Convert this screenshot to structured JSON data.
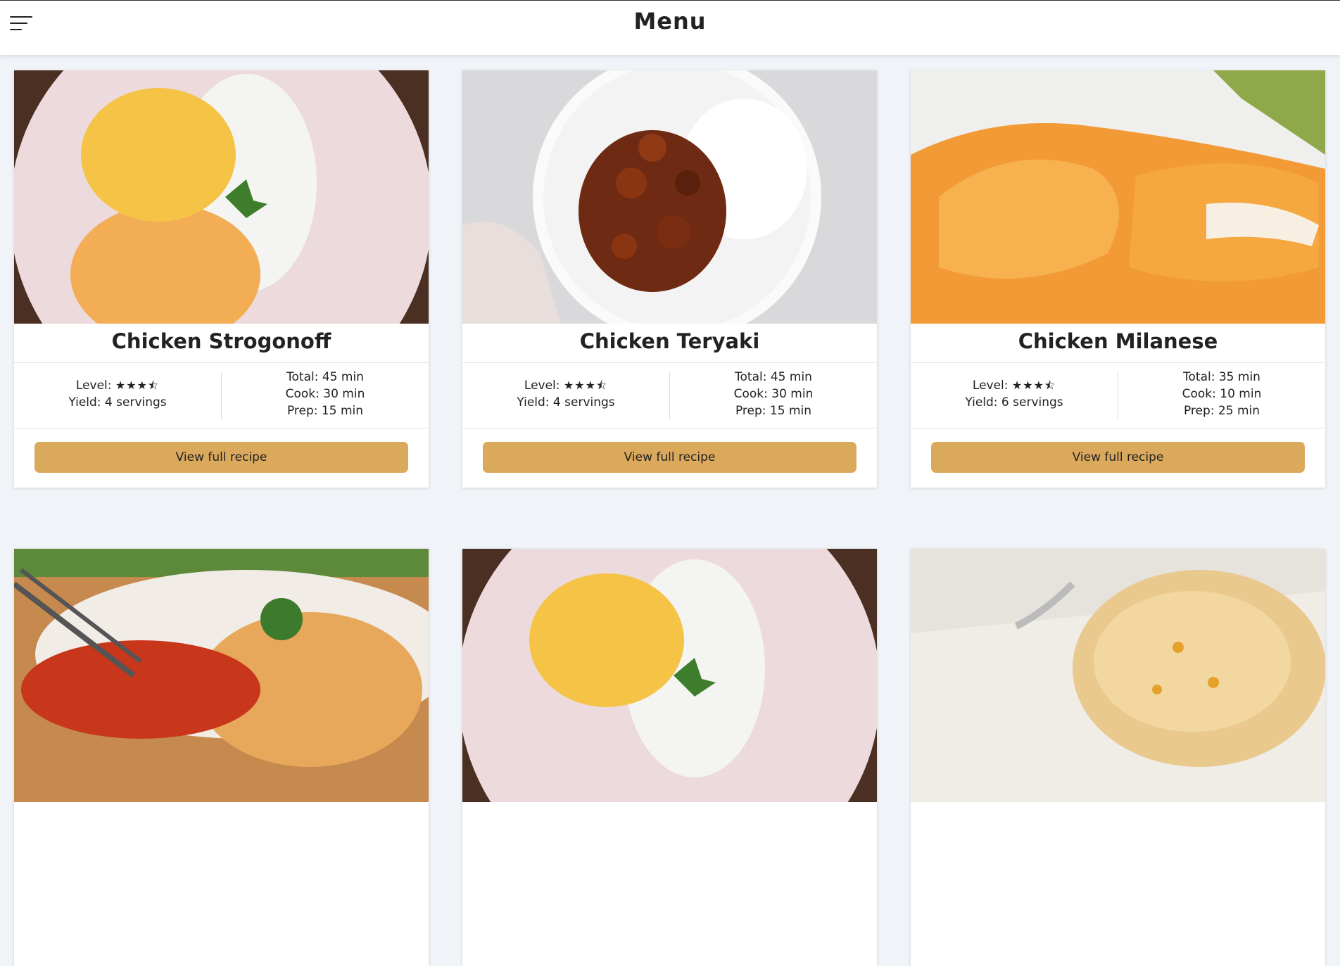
{
  "header": {
    "title": "Menu",
    "menu_icon": "hamburger-menu-icon"
  },
  "labels": {
    "level": "Level:",
    "button": "View full recipe"
  },
  "recipes": [
    {
      "title": "Chicken Strogonoff",
      "stars": "★★★⯪",
      "rating": 3.5,
      "yield": "Yield: 4 servings",
      "total": "Total: 45 min",
      "cook": "Cook: 30 min",
      "prep": "Prep: 15 min"
    },
    {
      "title": "Chicken Teryaki",
      "stars": "★★★⯪",
      "rating": 3.5,
      "yield": "Yield: 4 servings",
      "total": "Total: 45 min",
      "cook": "Cook: 30 min",
      "prep": "Prep: 15 min"
    },
    {
      "title": "Chicken Milanese",
      "stars": "★★★⯪",
      "rating": 3.5,
      "yield": "Yield: 6 servings",
      "total": "Total: 35 min",
      "cook": "Cook: 10 min",
      "prep": "Prep: 25 min"
    }
  ],
  "colors": {
    "accent": "#dba95c",
    "background": "#f0f3f7"
  }
}
